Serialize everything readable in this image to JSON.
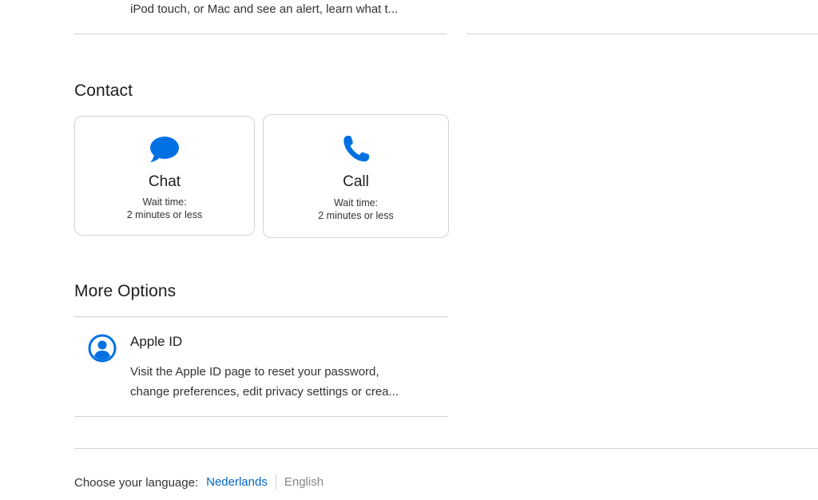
{
  "previous_article": {
    "text": "iPod touch, or Mac and see an alert, learn what t..."
  },
  "contact": {
    "title": "Contact",
    "chat": {
      "icon": "chat-bubble-icon",
      "label": "Chat",
      "wait_label": "Wait time:",
      "wait_value": "2 minutes or less"
    },
    "call": {
      "icon": "phone-icon",
      "label": "Call",
      "wait_label": "Wait time:",
      "wait_value": "2 minutes or less"
    }
  },
  "more_options": {
    "title": "More Options",
    "items": [
      {
        "icon": "person-circle-icon",
        "title": "Apple ID",
        "description_line1": "Visit the Apple ID page to reset your password,",
        "description_line2": "change preferences, edit privacy settings or crea..."
      }
    ]
  },
  "footer": {
    "language_label": "Choose your language:",
    "language_option": "Nederlands",
    "language_current": "English"
  },
  "colors": {
    "accent_blue": "#0071e3",
    "link_blue": "#0066cc",
    "divider": "#d2d2d7",
    "text_primary": "#1d1d1f",
    "text_muted": "#86868b"
  }
}
